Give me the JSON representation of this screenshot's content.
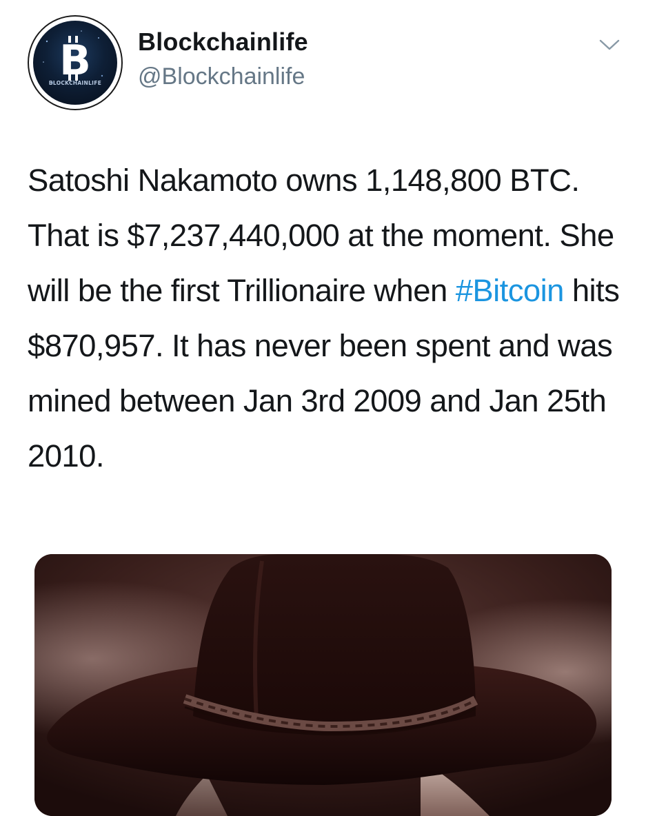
{
  "account": {
    "display_name": "Blockchainlife",
    "handle": "@Blockchainlife",
    "avatar_logo_text": "BLOCKCHAINLIFE",
    "avatar_icon": "bitcoin-icon"
  },
  "menu": {
    "icon": "chevron-down-icon"
  },
  "tweet": {
    "text_before_hashtag": "Satoshi Nakamoto owns 1,148,800 BTC.  That is $7,237,440,000 at the moment.  She will be the first Trillionaire when ",
    "hashtag": "#Bitcoin",
    "text_after_hashtag": " hits $870,957.  It has never been spent and was mined between Jan 3rd 2009 and Jan 25th 2010."
  },
  "media": {
    "subject": "cowboy-hat-photo"
  },
  "colors": {
    "link": "#1b95e0",
    "text": "#14171a",
    "secondary_text": "#657786",
    "avatar_ring": "#1a1a1a",
    "photo_tone": "#2a1513"
  }
}
